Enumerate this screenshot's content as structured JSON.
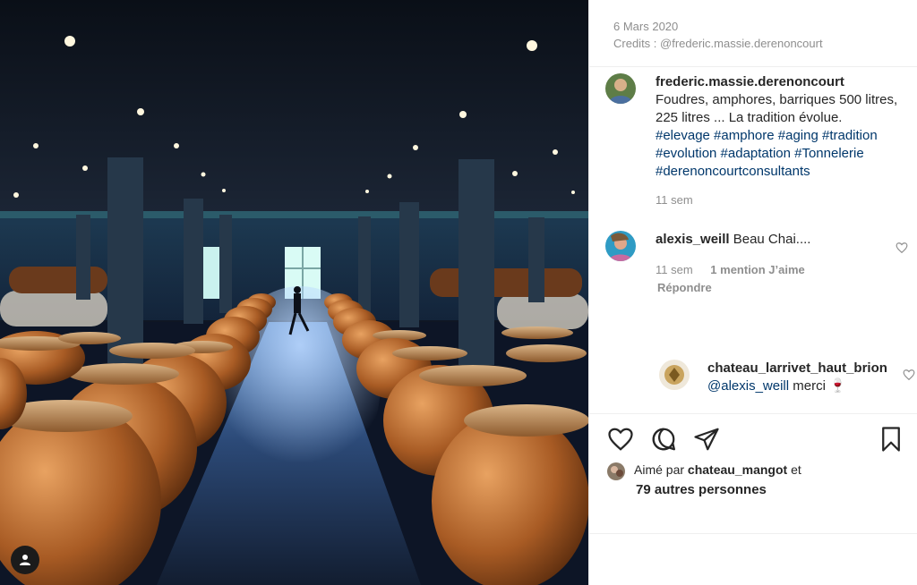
{
  "post": {
    "date": "6 Mars 2020",
    "credits": "Credits : @frederic.massie.derenoncourt",
    "author": "frederic.massie.derenoncourt",
    "caption": "Foudres, amphores, barriques 500 litres, 225 litres ... La tradition évolue.",
    "hashtags": "#elevage #amphore #aging #tradition #evolution #adaptation #Tonnelerie #derenoncourtconsultants",
    "time": "11 sem"
  },
  "comment": {
    "user": "alexis_weill",
    "text": "Beau Chai....",
    "time": "11 sem",
    "likes": "1 mention J’aime",
    "reply_label": "Répondre"
  },
  "reply": {
    "user": "chateau_larrivet_haut_brion",
    "mention": "@alexis_weill",
    "text": "merci 🍷"
  },
  "likes": {
    "prefix": "Aimé par",
    "user": "chateau_mangot",
    "suffix": "et",
    "others": "79 autres personnes"
  },
  "icons": {
    "like": "heart-icon",
    "comment": "comment-icon",
    "share": "paper-plane-icon",
    "save": "bookmark-icon",
    "tag": "user-tag-icon"
  },
  "colors": {
    "hashtag": "#00376b",
    "muted": "#8e8e8e",
    "text": "#262626"
  }
}
